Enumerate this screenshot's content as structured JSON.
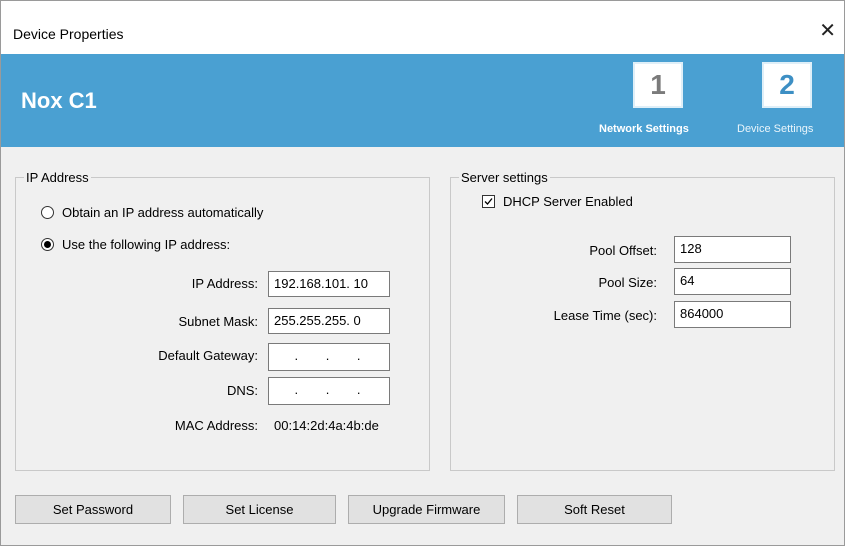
{
  "window": {
    "title": "Device Properties",
    "close_glyph": "✕"
  },
  "banner": {
    "device_name": "Nox C1",
    "steps": [
      {
        "number": "1",
        "label": "Network Settings",
        "active": true
      },
      {
        "number": "2",
        "label": "Device Settings",
        "active": false
      }
    ],
    "background_color": "#4aa0d2"
  },
  "ip_group": {
    "legend": "IP Address",
    "radio_auto": "Obtain an IP address automatically",
    "radio_manual": "Use the following IP address:",
    "selected": "manual",
    "fields": {
      "ip_label": "IP Address:",
      "ip_value": "192.168.101. 10",
      "subnet_label": "Subnet Mask:",
      "subnet_value": "255.255.255. 0",
      "gateway_label": "Default Gateway:",
      "gateway_value": ". . .",
      "dns_label": "DNS:",
      "dns_value": ". . .",
      "mac_label": "MAC Address:",
      "mac_value": "00:14:2d:4a:4b:de"
    }
  },
  "server_group": {
    "legend": "Server settings",
    "dhcp_label": "DHCP Server Enabled",
    "dhcp_checked": true,
    "pool_offset_label": "Pool Offset:",
    "pool_offset_value": "128",
    "pool_size_label": "Pool Size:",
    "pool_size_value": "64",
    "lease_label": "Lease Time (sec):",
    "lease_value": "864000"
  },
  "buttons": {
    "set_password": "Set Password",
    "set_license": "Set License",
    "upgrade_firmware": "Upgrade Firmware",
    "soft_reset": "Soft Reset"
  }
}
